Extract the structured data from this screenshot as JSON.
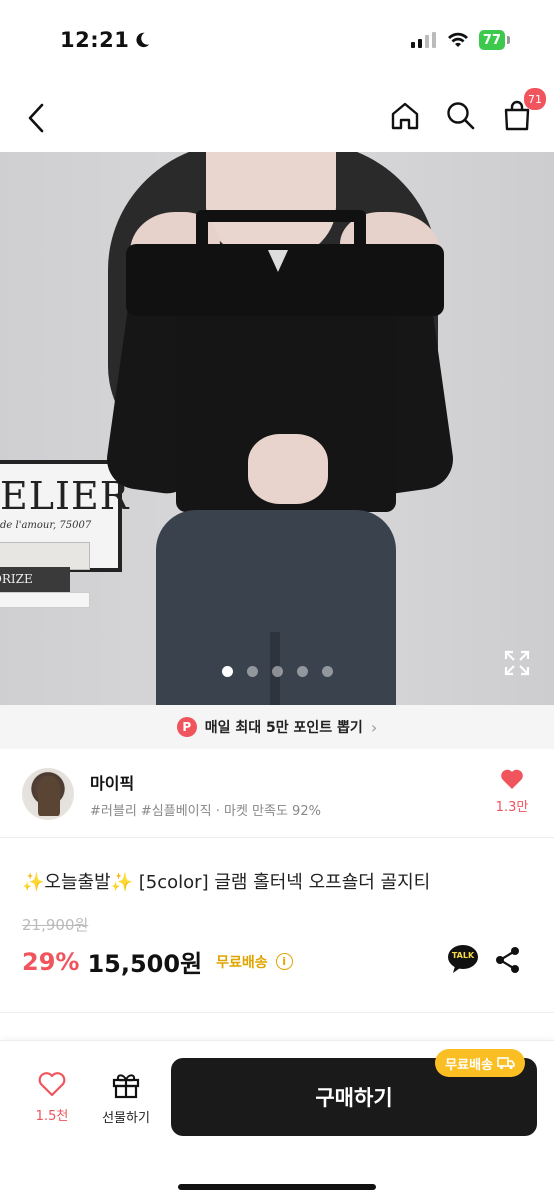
{
  "status_bar": {
    "time": "12:21",
    "battery": "77"
  },
  "nav": {
    "cart_count": "71"
  },
  "gallery": {
    "total": 5,
    "active_index": 0
  },
  "banner": {
    "badge": "P",
    "text": "매일 최대 5만 포인트 뽑기"
  },
  "image_text": {
    "frame_title": "ELIER",
    "frame_sub": "de l'amour, 75007",
    "book_spine": "ORIZE"
  },
  "seller": {
    "name": "마이픽",
    "tags": "#러블리 #심플베이직 · 마켓 만족도 92%",
    "likes": "1.3만"
  },
  "product": {
    "title": "✨오늘출발✨ [5color] 글램 홀터넥 오프숄더 골지티",
    "original_price": "21,900원",
    "discount": "29%",
    "price": "15,500원",
    "shipping": "무료배송",
    "talk_label": "TALK"
  },
  "bottom_bar": {
    "likes": "1.5천",
    "gift_label": "선물하기",
    "buy_label": "구매하기",
    "buy_badge": "무료배송"
  },
  "colors": {
    "accent": "#f0555d",
    "shipping": "#e0a500",
    "badge": "#fbbf24",
    "buy_button": "#1a1a1a"
  }
}
